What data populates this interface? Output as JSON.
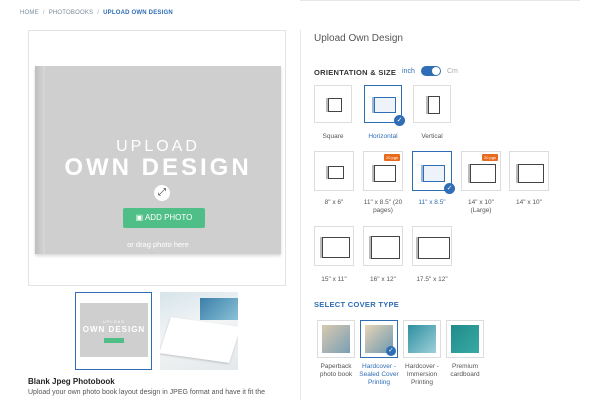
{
  "breadcrumb": {
    "home": "HOME",
    "sep": "/",
    "photobooks": "PHOTOBOOKS",
    "current": "UPLOAD OWN DESIGN"
  },
  "preview": {
    "upload_line1": "UPLOAD",
    "upload_line2": "OWN DESIGN",
    "add_photo": "ADD PHOTO",
    "drag_hint": "or drag photo here",
    "thumb_line1": "UPLOAD",
    "thumb_line2": "OWN DESIGN"
  },
  "product": {
    "name": "Blank Jpeg Photobook",
    "description": "Upload your own photo book layout design in JPEG format and have it fit the"
  },
  "panel": {
    "title": "Upload Own Design"
  },
  "orientation": {
    "label": "ORIENTATION & SIZE",
    "unit_inch": "inch",
    "unit_cm": "Cm",
    "unit_selected": "inch",
    "options": [
      {
        "label": "Square",
        "selected": false
      },
      {
        "label": "Horizontal",
        "selected": true
      },
      {
        "label": "Vertical",
        "selected": false
      }
    ]
  },
  "sizes": {
    "row1": [
      {
        "label": "8\" x 6\"",
        "selected": false,
        "badge": ""
      },
      {
        "label": "11\" x 8.5\" (20 pages)",
        "selected": false,
        "badge": "20 pgs"
      },
      {
        "label": "11\" x 8.5\"",
        "selected": true,
        "badge": ""
      },
      {
        "label": "14\" x 10\" (Large)",
        "selected": false,
        "badge": "20 pgs"
      },
      {
        "label": "14\" x 10\"",
        "selected": false,
        "badge": ""
      }
    ],
    "row2": [
      {
        "label": "15\" x 11\"",
        "selected": false
      },
      {
        "label": "16\" x 12\"",
        "selected": false
      },
      {
        "label": "17.5\" x 12\"",
        "selected": false
      }
    ]
  },
  "cover": {
    "label": "SELECT COVER TYPE",
    "options": [
      {
        "label": "Paperback photo book",
        "selected": false
      },
      {
        "label": "Hardcover - Sealed Cover Printing",
        "selected": true
      },
      {
        "label": "Hardcover - Immersion Printing",
        "selected": false
      },
      {
        "label": "Premium cardboard",
        "selected": false
      }
    ]
  },
  "colors": {
    "accent": "#2f6db5",
    "add_button": "#4fbf87",
    "badge": "#e86a1c"
  }
}
